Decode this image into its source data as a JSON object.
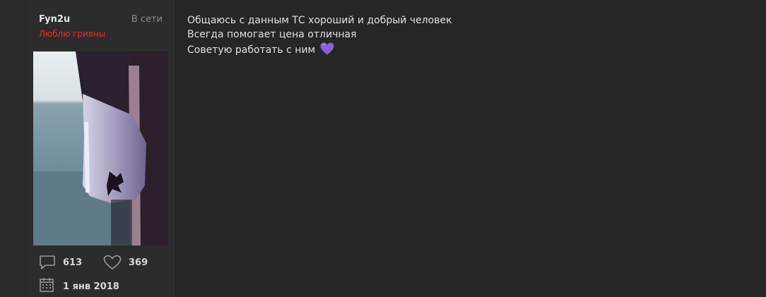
{
  "user": {
    "name": "Fyn2u",
    "status": "В сети",
    "title": "Люблю гривны",
    "title_color": "#ef2a2a",
    "avatar_icon": "avatar-image",
    "stats": {
      "messages": "613",
      "likes": "369",
      "registered": "1 янв 2018"
    }
  },
  "message": {
    "lines": [
      "Общаюсь с данным ТС хороший и добрый человек",
      "Всегда помогает цена отличная",
      "Советую работать с ним"
    ],
    "emoji": "purple-heart-icon",
    "emoji_color": "#8b5fd6"
  }
}
